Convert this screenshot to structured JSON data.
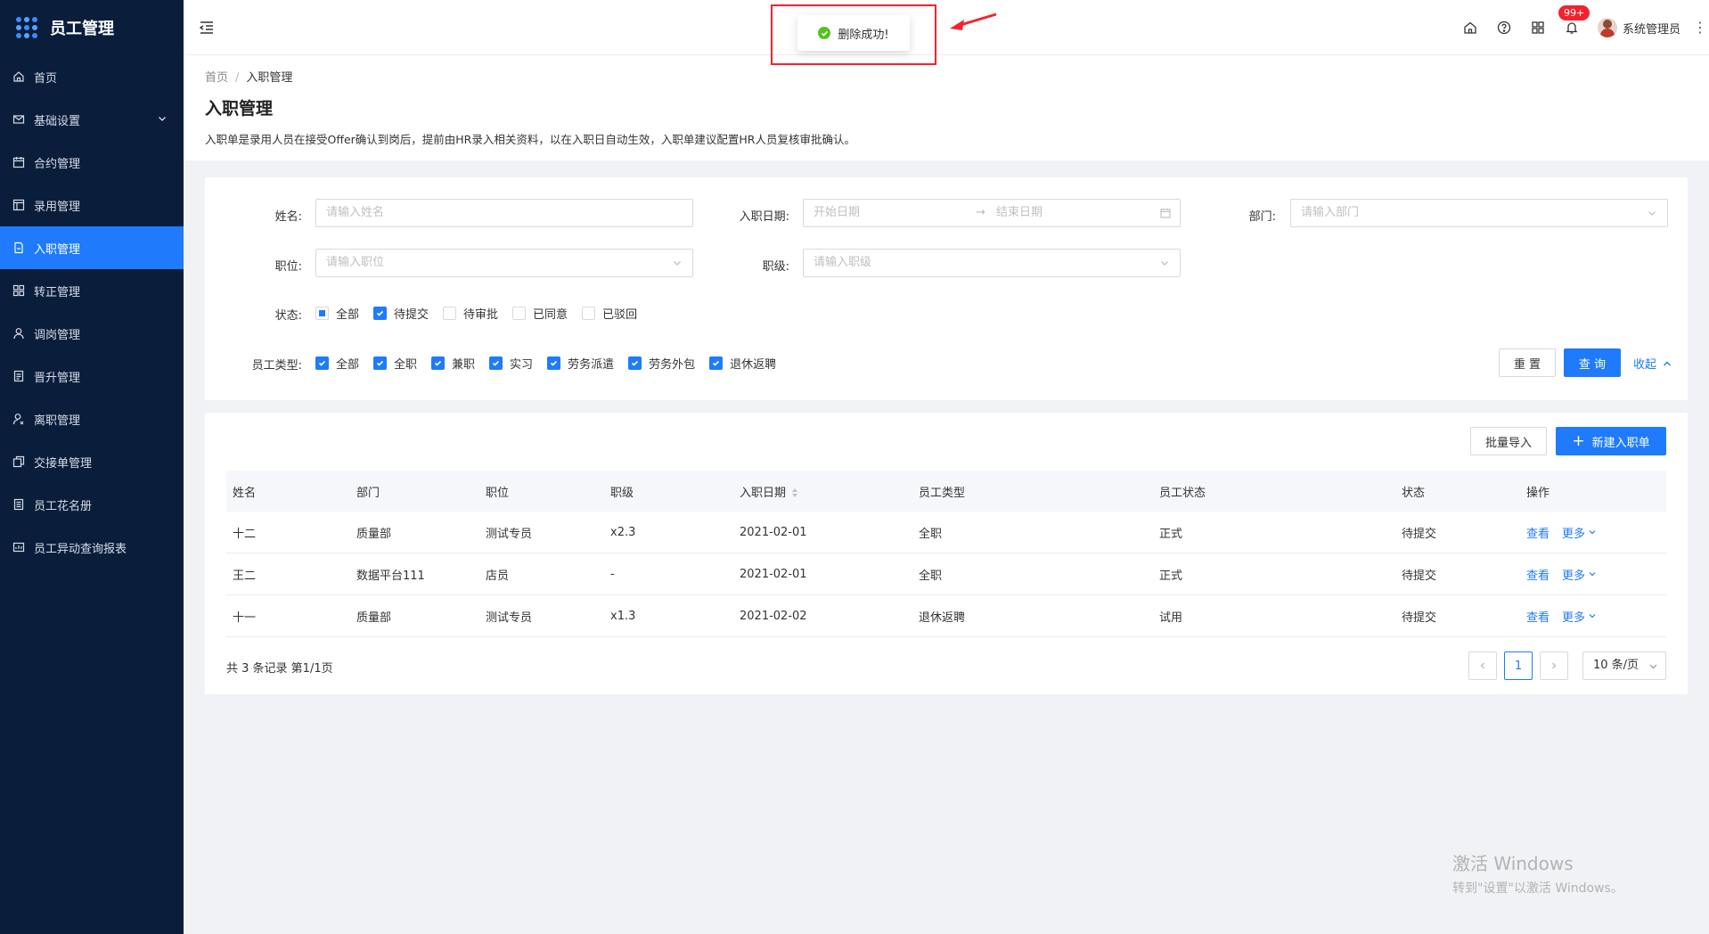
{
  "app": {
    "title": "员工管理"
  },
  "sidebar": {
    "items": [
      {
        "label": "首页",
        "icon": "home-icon"
      },
      {
        "label": "基础设置",
        "icon": "mail-icon"
      },
      {
        "label": "合约管理",
        "icon": "calendar-icon"
      },
      {
        "label": "录用管理",
        "icon": "layout-icon"
      },
      {
        "label": "入职管理",
        "icon": "document-icon",
        "active": true
      },
      {
        "label": "转正管理",
        "icon": "grid-icon"
      },
      {
        "label": "调岗管理",
        "icon": "user-icon"
      },
      {
        "label": "晋升管理",
        "icon": "file-icon"
      },
      {
        "label": "离职管理",
        "icon": "user-leave-icon"
      },
      {
        "label": "交接单管理",
        "icon": "copy-icon"
      },
      {
        "label": "员工花名册",
        "icon": "roster-icon"
      },
      {
        "label": "员工异动查询报表",
        "icon": "report-icon"
      }
    ]
  },
  "header": {
    "notifications_badge": "99+",
    "user_name": "系统管理员"
  },
  "toast": {
    "message": "删除成功!"
  },
  "page": {
    "breadcrumb": {
      "home": "首页",
      "current": "入职管理"
    },
    "title": "入职管理",
    "description": "入职单是录用人员在接受Offer确认到岗后，提前由HR录入相关资料，以在入职日自动生效，入职单建议配置HR人员复核审批确认。"
  },
  "filter": {
    "name": {
      "label": "姓名:",
      "placeholder": "请输入姓名"
    },
    "date": {
      "label": "入职日期:",
      "start_placeholder": "开始日期",
      "end_placeholder": "结束日期"
    },
    "dept": {
      "label": "部门:",
      "placeholder": "请输入部门"
    },
    "position": {
      "label": "职位:",
      "placeholder": "请输入职位"
    },
    "grade": {
      "label": "职级:",
      "placeholder": "请输入职级"
    },
    "status": {
      "label": "状态:",
      "options": [
        {
          "label": "全部",
          "state": "indeterminate"
        },
        {
          "label": "待提交",
          "state": "checked"
        },
        {
          "label": "待审批",
          "state": "unchecked"
        },
        {
          "label": "已同意",
          "state": "unchecked"
        },
        {
          "label": "已驳回",
          "state": "unchecked"
        }
      ]
    },
    "emp_type": {
      "label": "员工类型:",
      "options": [
        {
          "label": "全部",
          "state": "checked"
        },
        {
          "label": "全职",
          "state": "checked"
        },
        {
          "label": "兼职",
          "state": "checked"
        },
        {
          "label": "实习",
          "state": "checked"
        },
        {
          "label": "劳务派遣",
          "state": "checked"
        },
        {
          "label": "劳务外包",
          "state": "checked"
        },
        {
          "label": "退休返聘",
          "state": "checked"
        }
      ]
    },
    "reset_label": "重 置",
    "query_label": "查 询",
    "collapse_label": "收起"
  },
  "table": {
    "import_label": "批量导入",
    "new_label": "新建入职单",
    "columns": [
      "姓名",
      "部门",
      "职位",
      "职级",
      "入职日期",
      "员工类型",
      "员工状态",
      "状态",
      "操作"
    ],
    "rows": [
      {
        "name": "十二",
        "dept": "质量部",
        "position": "测试专员",
        "grade": "x2.3",
        "date": "2021-02-01",
        "type": "全职",
        "emp_status": "正式",
        "status": "待提交",
        "view": "查看",
        "more": "更多"
      },
      {
        "name": "王二",
        "dept": "数据平台111",
        "position": "店员",
        "grade": "-",
        "date": "2021-02-01",
        "type": "全职",
        "emp_status": "正式",
        "status": "待提交",
        "view": "查看",
        "more": "更多"
      },
      {
        "name": "十一",
        "dept": "质量部",
        "position": "测试专员",
        "grade": "x1.3",
        "date": "2021-02-02",
        "type": "退休返聘",
        "emp_status": "试用",
        "status": "待提交",
        "view": "查看",
        "more": "更多"
      }
    ],
    "total_text": "共 3 条记录 第1/1页",
    "current_page": "1",
    "page_size": "10 条/页"
  },
  "watermark": {
    "line1": "激活 Windows",
    "line2": "转到\"设置\"以激活 Windows。"
  },
  "colors": {
    "sidebar_bg": "#0a1e3c",
    "primary": "#1f7bfb",
    "success": "#52c41a",
    "danger": "#f5222d"
  }
}
